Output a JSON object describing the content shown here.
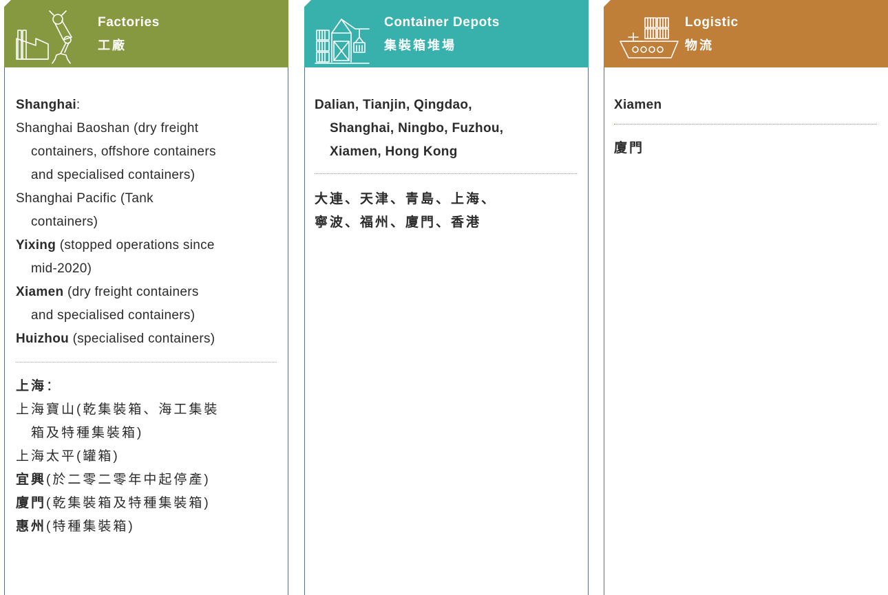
{
  "factories": {
    "title": "Factories",
    "title_zh": "工廠",
    "color": "#869940",
    "icon": "factory-robot-arm-icon",
    "en": {
      "heading": "Shanghai",
      "heading_suffix": ":",
      "l1": "Shanghai Baoshan (dry freight",
      "l2": "containers, offshore containers",
      "l3": "and specialised containers)",
      "l4": "Shanghai Pacific (Tank",
      "l5": "containers)",
      "yixing_name": "Yixing",
      "yixing_desc": " (stopped operations since",
      "yixing_cont": "mid-2020)",
      "xiamen_name": "Xiamen",
      "xiamen_desc": " (dry freight containers",
      "xiamen_cont": "and specialised containers)",
      "huizhou_name": "Huizhou",
      "huizhou_desc": " (specialised containers)"
    },
    "zh": {
      "heading": "上海",
      "heading_suffix": "：",
      "l1": "上海寶山(乾集裝箱、海工集裝",
      "l2": "箱及特種集裝箱)",
      "l3": "上海太平(罐箱)",
      "yixing_name": "宜興",
      "yixing_desc": "(於二零二零年中起停產)",
      "xiamen_name": "廈門",
      "xiamen_desc": "(乾集裝箱及特種集裝箱)",
      "huizhou_name": "惠州",
      "huizhou_desc": "(特種集裝箱)"
    }
  },
  "depots": {
    "title": "Container Depots",
    "title_zh": "集裝箱堆場",
    "color": "#38b0ac",
    "icon": "container-crane-icon",
    "en_l1": "Dalian, Tianjin, Qingdao,",
    "en_l2": "Shanghai, Ningbo, Fuzhou,",
    "en_l3": "Xiamen, Hong Kong",
    "zh_l1": "大連、天津、青島、上海、",
    "zh_l2": "寧波、福州、廈門、香港"
  },
  "logistic": {
    "title": "Logistic",
    "title_zh": "物流",
    "color": "#c07f38",
    "icon": "container-ship-icon",
    "en": "Xiamen",
    "zh": "廈門"
  }
}
